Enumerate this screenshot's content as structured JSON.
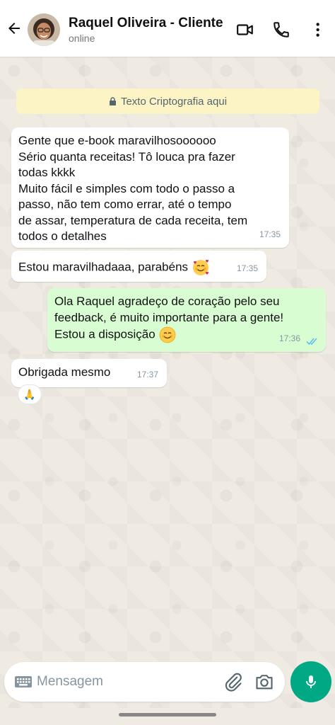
{
  "header": {
    "contact_name": "Raquel Oliveira - Cliente",
    "status": "online",
    "icons": [
      "back-arrow-icon",
      "video-call-icon",
      "phone-icon",
      "more-vert-icon"
    ]
  },
  "encryption_notice": "Texto Criptografia aqui",
  "messages": [
    {
      "direction": "in",
      "lines": [
        "Gente que e-book maravilhosoooooo",
        "Sério quanta receitas! Tô louca pra fazer",
        "todas kkkk",
        "Muito fácil e simples com todo o passo a",
        "passo, não tem como errar, até o tempo",
        "de assar, temperatura de cada receita, tem",
        "todos o detalhes"
      ],
      "time": "17:35"
    },
    {
      "direction": "in",
      "text": "Estou maravilhadaaa, parabéns",
      "emoji": "smiling-face-with-hearts",
      "time": "17:35"
    },
    {
      "direction": "out",
      "lines": [
        "Ola Raquel agradeço de coração pelo seu",
        "feedback, é muito importante para a gente!",
        "Estou a disposição"
      ],
      "emoji": "smiling-face",
      "time": "17:36",
      "read": true
    },
    {
      "direction": "in",
      "text": "Obrigada mesmo",
      "time": "17:37",
      "reaction": "🙏"
    }
  ],
  "input": {
    "placeholder": "Mensagem"
  },
  "colors": {
    "accent": "#00a884",
    "outgoing_bubble": "#d9fdd3",
    "incoming_bubble": "#ffffff",
    "notice_bg": "#fdf4c5",
    "read_ticks": "#53bdeb",
    "chat_bg": "#efeae2"
  }
}
